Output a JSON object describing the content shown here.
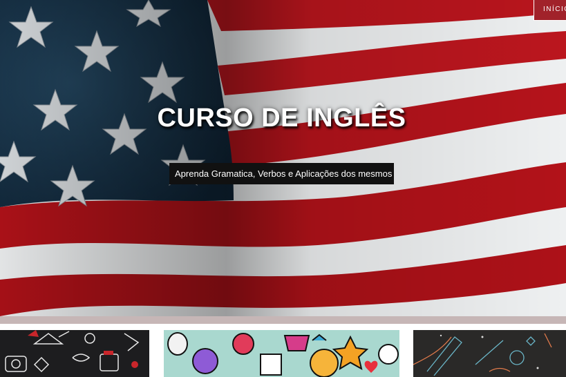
{
  "nav": {
    "inicio_label": "INÍCIO"
  },
  "hero": {
    "title": "CURSO DE INGLÊS",
    "subtitle": "Aprenda Gramatica, Verbos e Aplicações dos mesmos"
  },
  "colors": {
    "flag_red": "#b7141c",
    "flag_white": "#f1f1f1",
    "flag_blue": "#16324a",
    "nav_bg": "#a1222a",
    "divider": "#c6b6b6",
    "subtitle_bg": "#111111"
  },
  "cards": [
    {
      "image": "christmas-doodle-pattern"
    },
    {
      "image": "graffiti-cartoon-pattern"
    },
    {
      "image": "space-rocket-chalk-pattern"
    }
  ]
}
